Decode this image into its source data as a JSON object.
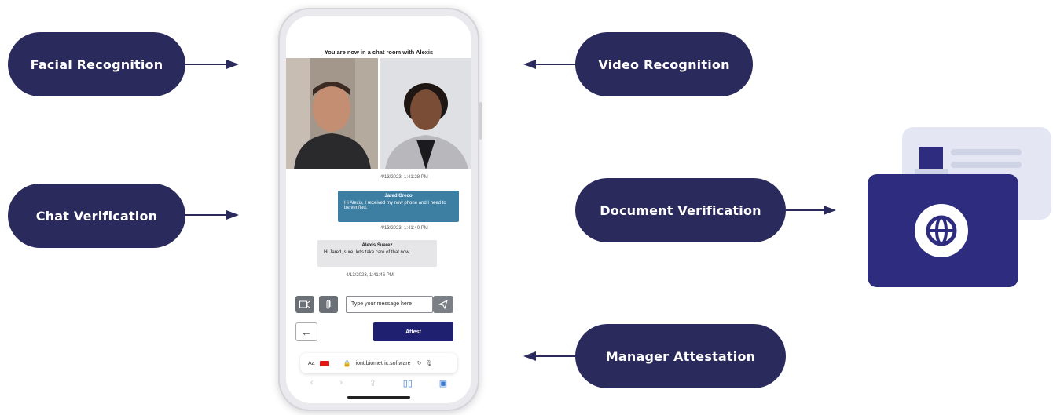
{
  "features": {
    "facial_recognition": "Facial Recognition",
    "chat_verification": "Chat Verification",
    "video_recognition": "Video Recognition",
    "document_verification": "Document Verification",
    "manager_attestation": "Manager Attestation"
  },
  "phone": {
    "chat_title": "You are now in a chat room with Alexis",
    "messages": [
      {
        "timestamp": "4/13/2023, 1:41:28 PM"
      },
      {
        "sender": "Jared Greco",
        "text": "Hi Alexis, I received my new phone and I need to be verified.",
        "timestamp": "4/13/2023, 1:41:40 PM"
      },
      {
        "sender": "Alexis Suarez",
        "text": "Hi Jared, sure, let's take care of that now.",
        "timestamp": "4/13/2023, 1:41:46 PM"
      }
    ],
    "message_placeholder": "Type your message here",
    "attest_label": "Attest",
    "url_aa": "Aa",
    "url": "iont.biometric.software"
  },
  "colors": {
    "pill": "#2b2a5c",
    "id_card": "#2e2c7e",
    "id_card_back": "#e4e7f3",
    "chat_bubble_sender": "#3d7fa3",
    "attest_button": "#202070"
  }
}
